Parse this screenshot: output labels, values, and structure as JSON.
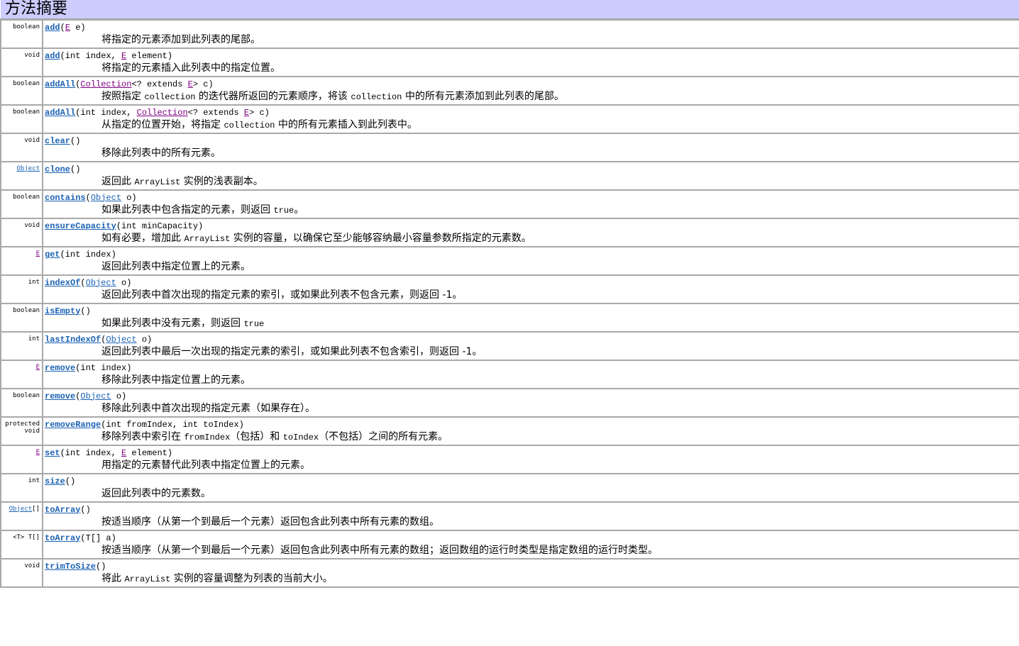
{
  "header": {
    "title": "方法摘要"
  },
  "colors": {
    "header_bg": "#ccccff",
    "method_link": "#1b62b4",
    "type_param_link": "#800080",
    "border": "#a9a9a9"
  },
  "methods": [
    {
      "ret": [
        {
          "t": "boolean"
        }
      ],
      "name": "add",
      "params": [
        {
          "t": "("
        },
        {
          "t": "E",
          "k": "tp"
        },
        {
          "t": " e)"
        }
      ],
      "desc": [
        {
          "t": "将指定的元素添加到此列表的尾部。"
        }
      ]
    },
    {
      "ret": [
        {
          "t": "void"
        }
      ],
      "name": "add",
      "params": [
        {
          "t": "(int index, "
        },
        {
          "t": "E",
          "k": "tp"
        },
        {
          "t": " element)"
        }
      ],
      "desc": [
        {
          "t": "将指定的元素插入此列表中的指定位置。"
        }
      ]
    },
    {
      "ret": [
        {
          "t": "boolean"
        }
      ],
      "name": "addAll",
      "params": [
        {
          "t": "("
        },
        {
          "t": "Collection",
          "k": "tp"
        },
        {
          "t": "<? extends "
        },
        {
          "t": "E",
          "k": "tp"
        },
        {
          "t": "> c)"
        }
      ],
      "desc": [
        {
          "t": "按照指定 "
        },
        {
          "t": "collection",
          "k": "code"
        },
        {
          "t": " 的迭代器所返回的元素顺序，将该 "
        },
        {
          "t": "collection",
          "k": "code"
        },
        {
          "t": " 中的所有元素添加到此列表的尾部。"
        }
      ]
    },
    {
      "ret": [
        {
          "t": "boolean"
        }
      ],
      "name": "addAll",
      "params": [
        {
          "t": "(int index, "
        },
        {
          "t": "Collection",
          "k": "tp"
        },
        {
          "t": "<? extends "
        },
        {
          "t": "E",
          "k": "tp"
        },
        {
          "t": "> c)"
        }
      ],
      "desc": [
        {
          "t": "从指定的位置开始，将指定 "
        },
        {
          "t": "collection",
          "k": "code"
        },
        {
          "t": " 中的所有元素插入到此列表中。"
        }
      ]
    },
    {
      "ret": [
        {
          "t": "void"
        }
      ],
      "name": "clear",
      "params": [
        {
          "t": "()"
        }
      ],
      "desc": [
        {
          "t": "移除此列表中的所有元素。"
        }
      ]
    },
    {
      "ret": [
        {
          "t": "Object",
          "k": "obj"
        }
      ],
      "name": "clone",
      "params": [
        {
          "t": "()"
        }
      ],
      "desc": [
        {
          "t": "返回此 "
        },
        {
          "t": "ArrayList",
          "k": "code"
        },
        {
          "t": " 实例的浅表副本。"
        }
      ]
    },
    {
      "ret": [
        {
          "t": "boolean"
        }
      ],
      "name": "contains",
      "params": [
        {
          "t": "("
        },
        {
          "t": "Object",
          "k": "obj"
        },
        {
          "t": " o)"
        }
      ],
      "desc": [
        {
          "t": "如果此列表中包含指定的元素，则返回 "
        },
        {
          "t": "true",
          "k": "code"
        },
        {
          "t": "。"
        }
      ]
    },
    {
      "ret": [
        {
          "t": "void"
        }
      ],
      "name": "ensureCapacity",
      "params": [
        {
          "t": "(int minCapacity)"
        }
      ],
      "desc": [
        {
          "t": "如有必要，增加此 "
        },
        {
          "t": "ArrayList",
          "k": "code"
        },
        {
          "t": " 实例的容量，以确保它至少能够容纳最小容量参数所指定的元素数。"
        }
      ]
    },
    {
      "ret": [
        {
          "t": "E",
          "k": "tp"
        }
      ],
      "name": "get",
      "params": [
        {
          "t": "(int index)"
        }
      ],
      "desc": [
        {
          "t": "返回此列表中指定位置上的元素。"
        }
      ]
    },
    {
      "ret": [
        {
          "t": "int"
        }
      ],
      "name": "indexOf",
      "params": [
        {
          "t": "("
        },
        {
          "t": "Object",
          "k": "obj"
        },
        {
          "t": " o)"
        }
      ],
      "desc": [
        {
          "t": "返回此列表中首次出现的指定元素的索引，或如果此列表不包含元素，则返回 -1。"
        }
      ]
    },
    {
      "ret": [
        {
          "t": "boolean"
        }
      ],
      "name": "isEmpty",
      "params": [
        {
          "t": "()"
        }
      ],
      "desc": [
        {
          "t": "如果此列表中没有元素，则返回 "
        },
        {
          "t": "true",
          "k": "code"
        }
      ]
    },
    {
      "ret": [
        {
          "t": "int"
        }
      ],
      "name": "lastIndexOf",
      "params": [
        {
          "t": "("
        },
        {
          "t": "Object",
          "k": "obj"
        },
        {
          "t": " o)"
        }
      ],
      "desc": [
        {
          "t": "返回此列表中最后一次出现的指定元素的索引，或如果此列表不包含索引，则返回 -1。"
        }
      ]
    },
    {
      "ret": [
        {
          "t": "E",
          "k": "tp"
        }
      ],
      "name": "remove",
      "params": [
        {
          "t": "(int index)"
        }
      ],
      "desc": [
        {
          "t": "移除此列表中指定位置上的元素。"
        }
      ]
    },
    {
      "ret": [
        {
          "t": "boolean"
        }
      ],
      "name": "remove",
      "params": [
        {
          "t": "("
        },
        {
          "t": "Object",
          "k": "obj"
        },
        {
          "t": " o)"
        }
      ],
      "desc": [
        {
          "t": "移除此列表中首次出现的指定元素（如果存在）。"
        }
      ]
    },
    {
      "ret": [
        {
          "t": "protected"
        },
        {
          "t": "void",
          "br": true
        }
      ],
      "name": "removeRange",
      "params": [
        {
          "t": "(int fromIndex, int toIndex)"
        }
      ],
      "desc": [
        {
          "t": "移除列表中索引在 "
        },
        {
          "t": "fromIndex",
          "k": "code"
        },
        {
          "t": "（包括）和 "
        },
        {
          "t": "toIndex",
          "k": "code"
        },
        {
          "t": "（不包括）之间的所有元素。"
        }
      ]
    },
    {
      "ret": [
        {
          "t": "E",
          "k": "tp"
        }
      ],
      "name": "set",
      "params": [
        {
          "t": "(int index, "
        },
        {
          "t": "E",
          "k": "tp"
        },
        {
          "t": " element)"
        }
      ],
      "desc": [
        {
          "t": "用指定的元素替代此列表中指定位置上的元素。"
        }
      ]
    },
    {
      "ret": [
        {
          "t": "int"
        }
      ],
      "name": "size",
      "params": [
        {
          "t": "()"
        }
      ],
      "desc": [
        {
          "t": "返回此列表中的元素数。"
        }
      ]
    },
    {
      "ret": [
        {
          "t": "Object",
          "k": "obj"
        },
        {
          "t": "[]"
        }
      ],
      "name": "toArray",
      "params": [
        {
          "t": "()"
        }
      ],
      "desc": [
        {
          "t": "按适当顺序（从第一个到最后一个元素）返回包含此列表中所有元素的数组。"
        }
      ]
    },
    {
      "ret": [
        {
          "t": "<T> T[]"
        }
      ],
      "name": "toArray",
      "params": [
        {
          "t": "(T[] a)"
        }
      ],
      "desc": [
        {
          "t": "按适当顺序（从第一个到最后一个元素）返回包含此列表中所有元素的数组；返回数组的运行时类型是指定数组的运行时类型。"
        }
      ]
    },
    {
      "ret": [
        {
          "t": "void"
        }
      ],
      "name": "trimToSize",
      "params": [
        {
          "t": "()"
        }
      ],
      "desc": [
        {
          "t": "将此 "
        },
        {
          "t": "ArrayList",
          "k": "code"
        },
        {
          "t": " 实例的容量调整为列表的当前大小。"
        }
      ]
    }
  ]
}
